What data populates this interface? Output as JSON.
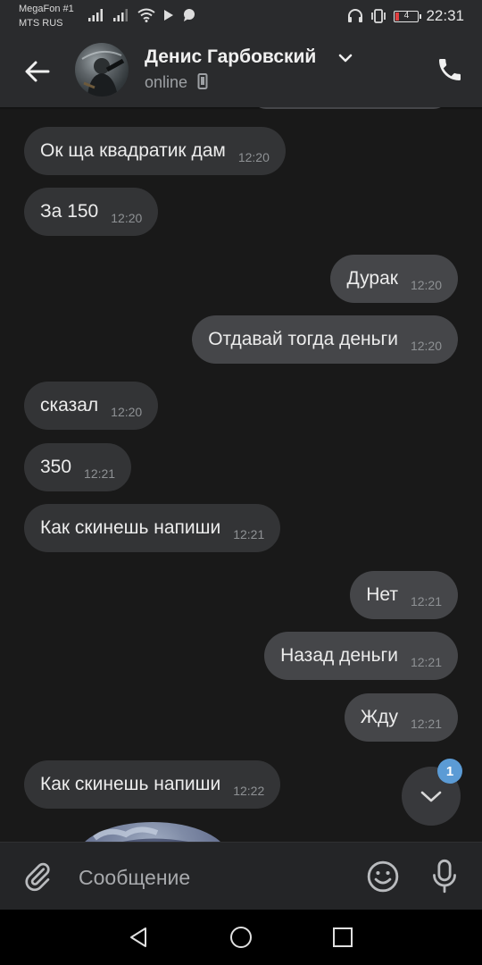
{
  "status_bar": {
    "carrier1": "MegaFon #1",
    "carrier2": "MTS RUS",
    "battery": "4",
    "time": "22:31"
  },
  "header": {
    "contact_name": "Денис Гарбовский",
    "status": "online"
  },
  "messages": [
    {
      "dir": "in",
      "text": "Ок ща квадратик дам",
      "time": "12:20"
    },
    {
      "dir": "in",
      "text": "За 150",
      "time": "12:20"
    },
    {
      "dir": "out",
      "text": "Дурак",
      "time": "12:20"
    },
    {
      "dir": "out",
      "text": "Отдавай тогда деньги",
      "time": "12:20"
    },
    {
      "dir": "in",
      "text": "сказал",
      "time": "12:20"
    },
    {
      "dir": "in",
      "text": "350",
      "time": "12:21"
    },
    {
      "dir": "in",
      "text": "Как скинешь напиши",
      "time": "12:21"
    },
    {
      "dir": "out",
      "text": "Нет",
      "time": "12:21"
    },
    {
      "dir": "out",
      "text": "Назад деньги",
      "time": "12:21"
    },
    {
      "dir": "out",
      "text": "Жду",
      "time": "12:21"
    },
    {
      "dir": "in",
      "text": "Как скинешь напиши",
      "time": "12:22"
    }
  ],
  "scroll_down": {
    "unread_count": "1"
  },
  "composer": {
    "placeholder": "Сообщение"
  },
  "colors": {
    "background": "#191919",
    "header": "#2a2b2d",
    "incoming_bubble": "#333436",
    "outgoing_bubble": "#454649",
    "badge": "#5b9bd5"
  }
}
